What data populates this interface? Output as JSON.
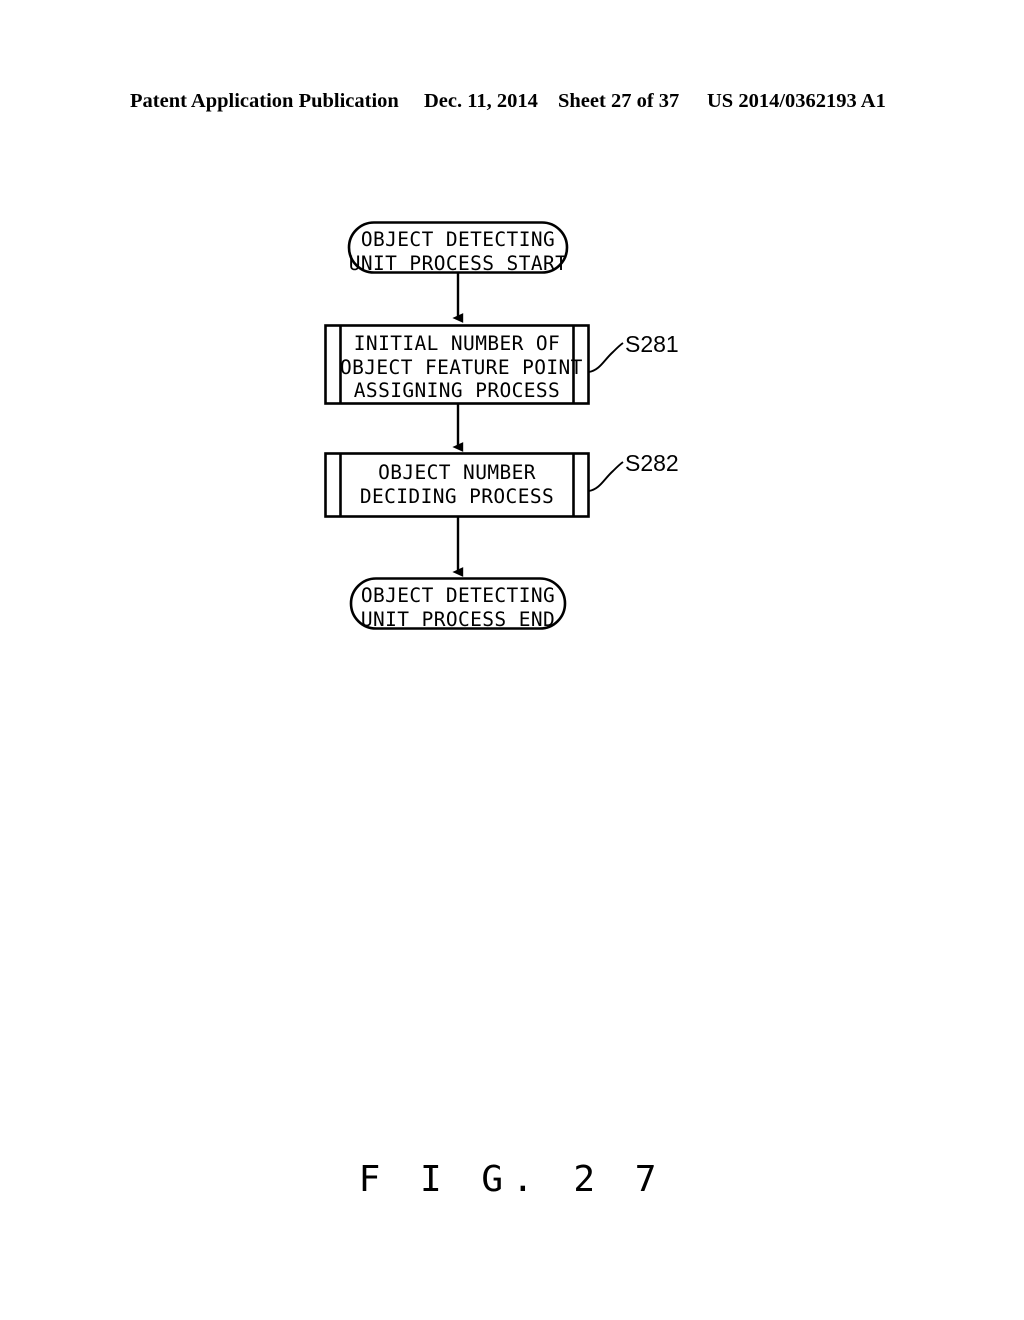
{
  "header": {
    "publication": "Patent Application Publication",
    "date": "Dec. 11, 2014",
    "sheet": "Sheet 27 of 37",
    "patent_number": "US 2014/0362193 A1"
  },
  "figure": {
    "caption": "F I G.  2 7",
    "type": "flowchart",
    "ink_color": "#000000",
    "background_color": "#ffffff"
  },
  "flowchart": {
    "nodes": [
      {
        "id": "terminal-start",
        "shape": "stadium",
        "line_1": "OBJECT DETECTING",
        "line_2": "UNIT PROCESS START"
      },
      {
        "id": "process-1",
        "shape": "predefined-process",
        "step": "S281",
        "line_1": "INITIAL NUMBER OF",
        "line_2": "OBJECT FEATURE POINT",
        "line_3": "ASSIGNING PROCESS"
      },
      {
        "id": "process-2",
        "shape": "predefined-process",
        "step": "S282",
        "line_1": "OBJECT NUMBER",
        "line_2": "DECIDING PROCESS"
      },
      {
        "id": "terminal-end",
        "shape": "stadium",
        "line_1": "OBJECT DETECTING",
        "line_2": "UNIT PROCESS END"
      }
    ],
    "connectors": [
      {
        "id": "connector-start-to-p1",
        "from": "terminal-start",
        "to": "process-1",
        "arrow": true
      },
      {
        "id": "connector-p1-to-p2",
        "from": "process-1",
        "to": "process-2",
        "arrow": true
      },
      {
        "id": "connector-p2-to-end",
        "from": "process-2",
        "to": "terminal-end",
        "arrow": true
      }
    ],
    "step_labels": [
      {
        "id": "step-label-s281",
        "text": "S281",
        "target": "process-1"
      },
      {
        "id": "step-label-s282",
        "text": "S282",
        "target": "process-2"
      }
    ]
  }
}
